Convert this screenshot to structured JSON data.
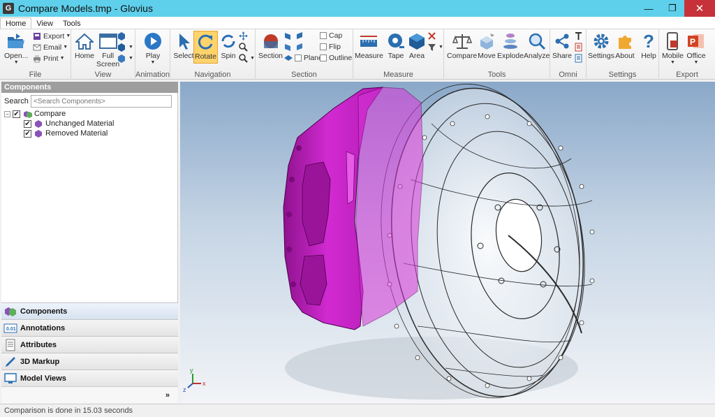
{
  "window": {
    "title": "Compare Models.tmp - Glovius",
    "app_icon_letter": "G",
    "minimize": "—",
    "maximize": "❐",
    "close": "✕"
  },
  "menu": {
    "tabs": [
      {
        "label": "Home",
        "active": true
      },
      {
        "label": "View",
        "active": false
      },
      {
        "label": "Tools",
        "active": false
      }
    ]
  },
  "ribbon": {
    "file": {
      "label": "File",
      "open": "Open...",
      "export": "Export",
      "email": "Email",
      "print": "Print"
    },
    "view": {
      "label": "View",
      "home": "Home",
      "full_screen_1": "Full",
      "full_screen_2": "Screen"
    },
    "animation": {
      "label": "Animation",
      "play": "Play"
    },
    "navigation": {
      "label": "Navigation",
      "select": "Select",
      "rotate": "Rotate",
      "spin": "Spin"
    },
    "section": {
      "label": "Section",
      "section": "Section",
      "cap": "Cap",
      "flip": "Flip",
      "plane": "Plane",
      "outline": "Outline"
    },
    "measure": {
      "label": "Measure",
      "measure": "Measure",
      "tape": "Tape",
      "area": "Area"
    },
    "tools": {
      "label": "Tools",
      "compare": "Compare",
      "move": "Move",
      "explode": "Explode",
      "analyze": "Analyze"
    },
    "omni": {
      "label": "Omni",
      "share": "Share"
    },
    "settings": {
      "label": "Settings",
      "settings": "Settings",
      "about": "About",
      "help": "Help"
    },
    "export": {
      "label": "Export",
      "mobile": "Mobile",
      "office": "Office"
    }
  },
  "components_panel": {
    "header": "Components",
    "search_label": "Search :",
    "search_placeholder": "<Search Components>",
    "tree": {
      "root": "Compare",
      "children": [
        "Unchanged Material",
        "Removed Material"
      ]
    }
  },
  "bottom_tabs": [
    {
      "label": "Components",
      "icon": "components-icon",
      "active": true
    },
    {
      "label": "Annotations",
      "icon": "annotations-icon",
      "active": false
    },
    {
      "label": "Attributes",
      "icon": "attributes-icon",
      "active": false
    },
    {
      "label": "3D Markup",
      "icon": "markup-pen-icon",
      "active": false
    },
    {
      "label": "Model Views",
      "icon": "model-views-icon",
      "active": false
    }
  ],
  "expand_label": "»",
  "axis": {
    "y": "y",
    "z": "z",
    "x": "x"
  },
  "status": "Comparison is done in 15.03 seconds",
  "colors": {
    "titlebar": "#5fd0ec",
    "removed_material": "#c81ec8",
    "active_tool": "#ffd36b",
    "close_button": "#c7323a"
  }
}
